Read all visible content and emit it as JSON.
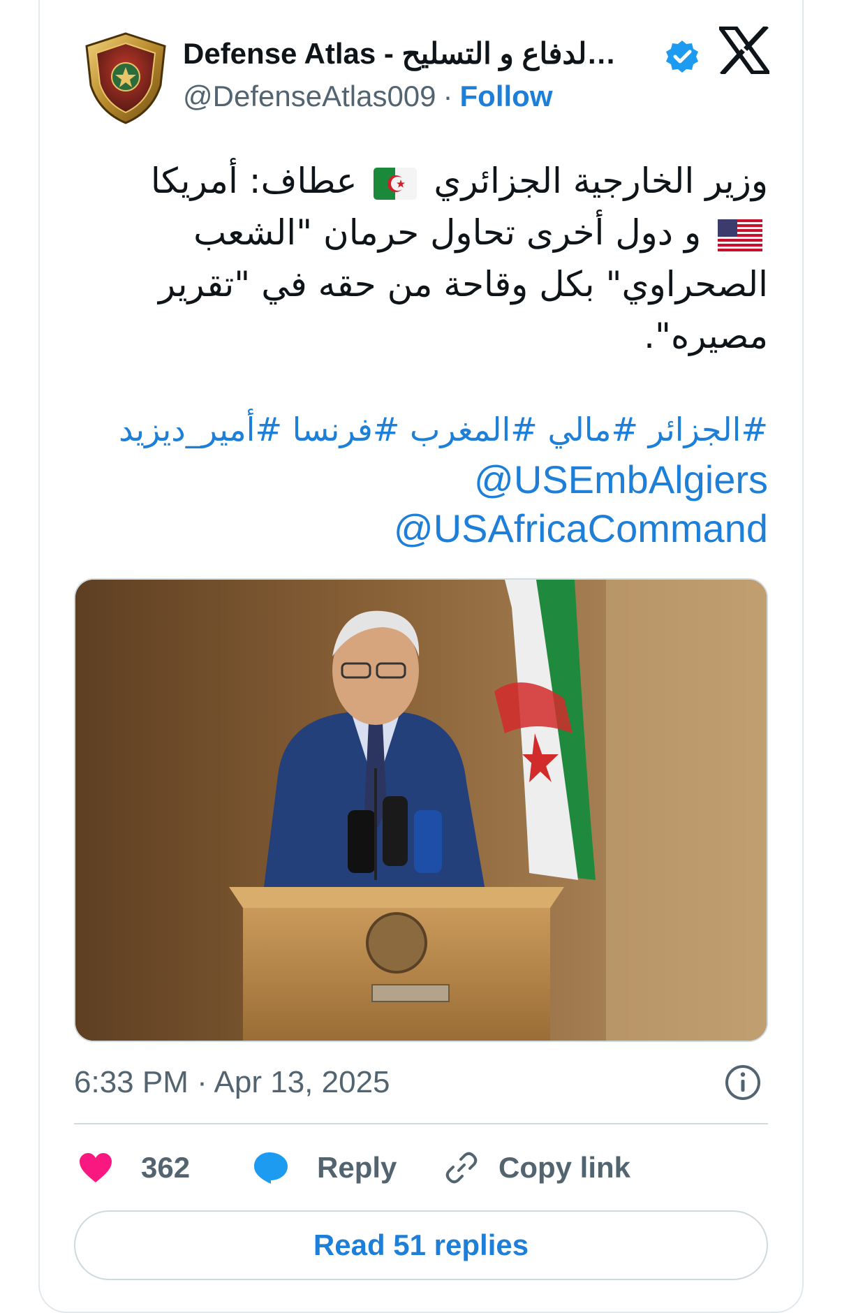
{
  "author": {
    "name": "Defense Atlas - لدفاع و التسليح…",
    "handle": "@DefenseAtlas009",
    "separator": "·",
    "follow_label": "Follow",
    "avatar_icon": "shield-crest-icon",
    "verified_icon": "verified-badge-icon"
  },
  "platform_logo": "x-logo-icon",
  "tweet": {
    "text_part1": "وزير الخارجية الجزائري",
    "text_part2": "عطاف: أمريكا",
    "text_part3": "و دول أخرى تحاول حرمان \"الشعب الصحراوي\" بكل وقاحة من حقه في \"تقرير مصيره\".",
    "flag_1": "algeria-flag-emoji",
    "flag_2": "us-flag-emoji",
    "hashtags": "#الجزائر #مالي #المغرب #فرنسا #أمير_ديزيد",
    "mentions": [
      "@USEmbAlgiers",
      "@USAfricaCommand"
    ]
  },
  "media": {
    "type": "photo",
    "subject": "speaker-at-podium-with-algerian-flag"
  },
  "meta": {
    "timestamp": "6:33 PM · Apr 13, 2025"
  },
  "actions": {
    "like_count": "362",
    "reply_label": "Reply",
    "copy_link_label": "Copy link"
  },
  "read_replies_label": "Read 51 replies",
  "colors": {
    "link_blue": "#1d7fd8",
    "like_pink": "#f91880",
    "muted_gray": "#536471",
    "border": "#cfd9de"
  }
}
